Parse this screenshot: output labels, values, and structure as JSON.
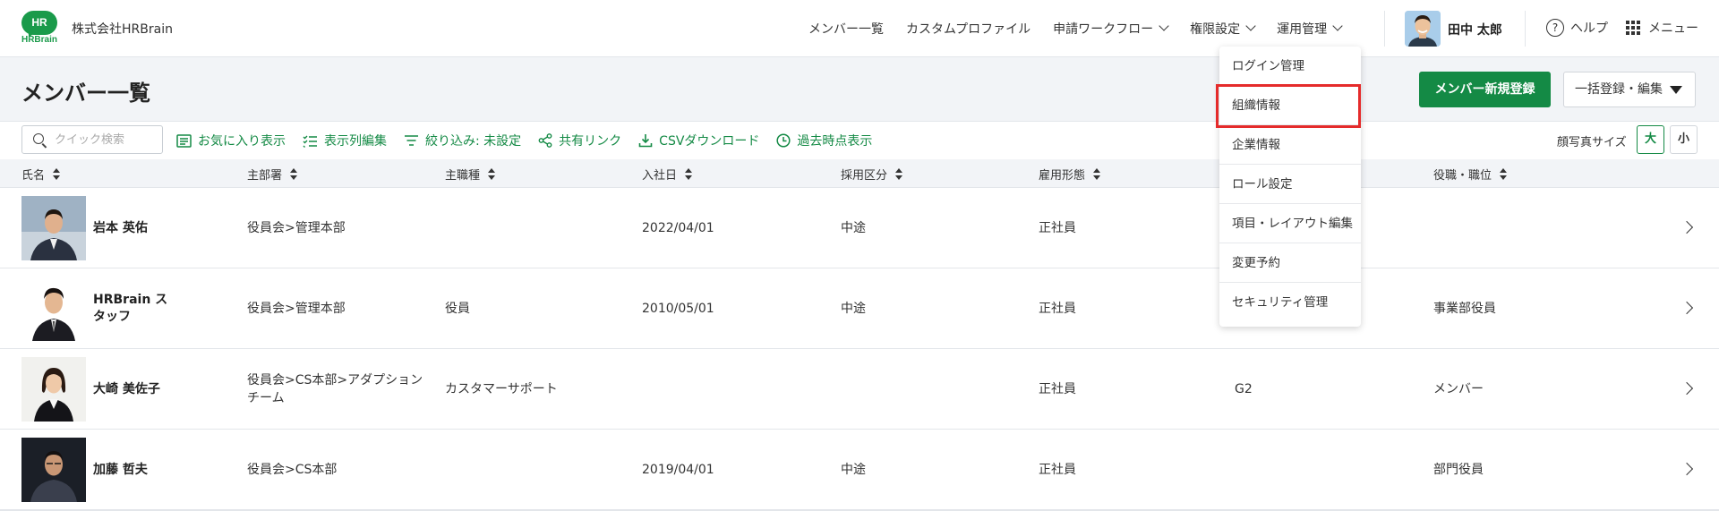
{
  "header": {
    "logo_text": "HR",
    "logo_word": "HRBrain",
    "company": "株式会社HRBrain",
    "nav": [
      "メンバー一覧",
      "カスタムプロファイル",
      "申請ワークフロー",
      "権限設定",
      "運用管理"
    ],
    "user_name": "田中 太郎",
    "help_label": "ヘルプ",
    "menu_label": "メニュー"
  },
  "page": {
    "title": "メンバー一覧",
    "new_button": "メンバー新規登録",
    "bulk_button": "一括登録・編集"
  },
  "toolbar": {
    "search_placeholder": "クイック検索",
    "favorites": "お気に入り表示",
    "columns": "表示列編集",
    "filter": "絞り込み: 未設定",
    "share": "共有リンク",
    "csv": "CSVダウンロード",
    "past": "過去時点表示",
    "photo_size_label": "顔写真サイズ",
    "size_large": "大",
    "size_small": "小"
  },
  "table": {
    "columns": [
      "氏名",
      "主部署",
      "主職種",
      "入社日",
      "採用区分",
      "雇用形態",
      "役職・職位"
    ],
    "rows": [
      {
        "name": "岩本 英佑",
        "dept": "役員会>管理本部",
        "job": "",
        "joined": "2022/04/01",
        "hire_type": "中途",
        "employment": "正社員",
        "grade": "",
        "position": ""
      },
      {
        "name": "HRBrain スタッフ",
        "dept": "役員会>管理本部",
        "job": "役員",
        "joined": "2010/05/01",
        "hire_type": "中途",
        "employment": "正社員",
        "grade": "",
        "position": "事業部役員"
      },
      {
        "name": "大崎 美佐子",
        "dept": "役員会>CS本部>アダプションチーム",
        "job": "カスタマーサポート",
        "joined": "",
        "hire_type": "",
        "employment": "正社員",
        "grade": "G2",
        "position": "メンバー"
      },
      {
        "name": "加藤 哲夫",
        "dept": "役員会>CS本部",
        "job": "",
        "joined": "2019/04/01",
        "hire_type": "中途",
        "employment": "正社員",
        "grade": "",
        "position": "部門役員"
      }
    ]
  },
  "dropdown": {
    "items": [
      "ログイン管理",
      "組織情報",
      "企業情報",
      "ロール設定",
      "項目・レイアウト編集",
      "変更予約",
      "セキュリティ管理"
    ],
    "highlighted": "組織情報"
  },
  "colors": {
    "brand_green": "#148a45",
    "highlight_red": "#e52b2b"
  }
}
